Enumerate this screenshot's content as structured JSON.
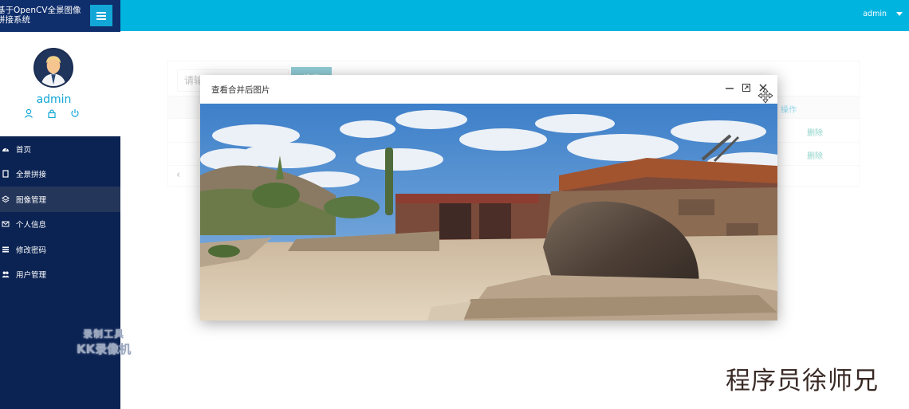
{
  "app": {
    "title": "基于OpenCV全景图像拼接系统",
    "user": "admin"
  },
  "topbar": {
    "user_label": "admin"
  },
  "profile": {
    "name": "admin",
    "icons": [
      "user-icon",
      "lock-icon",
      "power-icon"
    ]
  },
  "sidebar": {
    "items": [
      {
        "label": "首页",
        "icon": "dashboard-icon",
        "active": false
      },
      {
        "label": "全景拼接",
        "icon": "document-icon",
        "active": false
      },
      {
        "label": "图像管理",
        "icon": "layers-icon",
        "active": true
      },
      {
        "label": "个人信息",
        "icon": "envelope-icon",
        "active": false
      },
      {
        "label": "修改密码",
        "icon": "list-icon",
        "active": false
      },
      {
        "label": "用户管理",
        "icon": "users-icon",
        "active": false
      }
    ]
  },
  "main": {
    "search_placeholder": "请输入图片名",
    "search_button": "搜索",
    "table_header_op": "操作",
    "rows": [
      {
        "action": "删除"
      },
      {
        "action": "删除"
      }
    ],
    "pager_prev": "‹"
  },
  "modal": {
    "title": "查看合并后图片",
    "controls": [
      "minimize-icon",
      "maximize-icon",
      "close-icon"
    ]
  },
  "watermarks": {
    "recorder_line1": "录制工具",
    "recorder_line2": "KK录像机",
    "author": "程序员徐师兄"
  },
  "colors": {
    "sidebar_bg": "#0b2353",
    "topbar_bg": "#00b4e0",
    "accent": "#12a7d6",
    "delete_link": "#0aa08a"
  }
}
